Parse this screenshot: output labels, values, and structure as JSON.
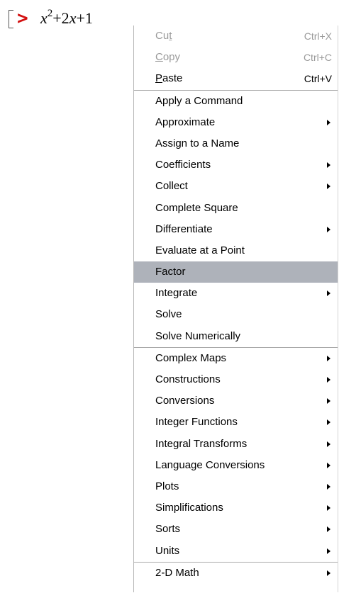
{
  "worksheet": {
    "prompt_symbol": ">",
    "expr": {
      "var1": "x",
      "exp": "2",
      "mid": "+2",
      "var2": "x",
      "tail": "+1"
    }
  },
  "menu": {
    "clipboard": [
      {
        "pre": "Cu",
        "acc": "t",
        "post": "",
        "shortcut": "Ctrl+X",
        "disabled": true
      },
      {
        "pre": "",
        "acc": "C",
        "post": "opy",
        "shortcut": "Ctrl+C",
        "disabled": true
      },
      {
        "pre": "",
        "acc": "P",
        "post": "aste",
        "shortcut": "Ctrl+V",
        "disabled": false
      }
    ],
    "commands": [
      {
        "label": "Apply a Command",
        "submenu": false
      },
      {
        "label": "Approximate",
        "submenu": true
      },
      {
        "label": "Assign to a Name",
        "submenu": false
      },
      {
        "label": "Coefficients",
        "submenu": true
      },
      {
        "label": "Collect",
        "submenu": true
      },
      {
        "label": "Complete Square",
        "submenu": false
      },
      {
        "label": "Differentiate",
        "submenu": true
      },
      {
        "label": "Evaluate at a Point",
        "submenu": false
      },
      {
        "label": "Factor",
        "submenu": false,
        "highlighted": true
      },
      {
        "label": "Integrate",
        "submenu": true
      },
      {
        "label": "Solve",
        "submenu": false
      },
      {
        "label": "Solve Numerically",
        "submenu": false
      }
    ],
    "packages": [
      {
        "label": "Complex Maps",
        "submenu": true
      },
      {
        "label": "Constructions",
        "submenu": true
      },
      {
        "label": "Conversions",
        "submenu": true
      },
      {
        "label": "Integer Functions",
        "submenu": true
      },
      {
        "label": "Integral Transforms",
        "submenu": true
      },
      {
        "label": "Language Conversions",
        "submenu": true
      },
      {
        "label": "Plots",
        "submenu": true
      },
      {
        "label": "Simplifications",
        "submenu": true
      },
      {
        "label": "Sorts",
        "submenu": true
      },
      {
        "label": "Units",
        "submenu": true
      }
    ],
    "display": [
      {
        "label": "2-D Math",
        "submenu": true
      }
    ]
  },
  "colors": {
    "prompt": "#d30f0f",
    "highlight": "#aeb2ba",
    "disabled_text": "#9a9a9a"
  }
}
